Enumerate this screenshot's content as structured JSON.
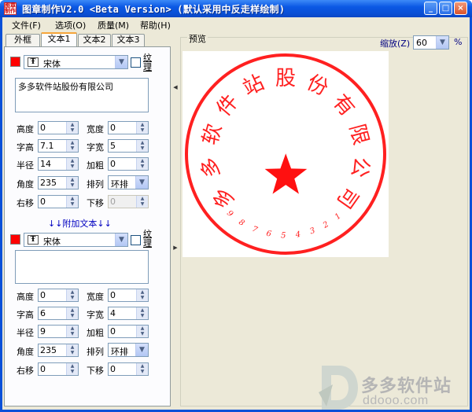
{
  "window": {
    "title": "图章制作V2.0 <Beta Version> (默认采用中反走样绘制)",
    "icon_text": "图章制作",
    "buttons": {
      "minimize": "_",
      "maximize": "□",
      "close": "×"
    }
  },
  "menu": [
    "文件(F)",
    "选项(O)",
    "质量(M)",
    "帮助(H)"
  ],
  "tabs": [
    {
      "label": "外框",
      "active": false
    },
    {
      "label": "文本1",
      "active": true
    },
    {
      "label": "文本2",
      "active": false
    },
    {
      "label": "文本3",
      "active": false
    }
  ],
  "text1": {
    "color": "#ff0000",
    "font": "宋体",
    "font_icon": "Ŧ",
    "texture_label": "纹理",
    "content": "多多软件站股份有限公司",
    "fields": {
      "height_label": "高度",
      "height": "0",
      "width_label": "宽度",
      "width": "0",
      "char_height_label": "字高",
      "char_height": "7.1",
      "char_width_label": "字宽",
      "char_width": "5",
      "radius_label": "半径",
      "radius": "14",
      "bold_label": "加粗",
      "bold": "0",
      "angle_label": "角度",
      "angle": "235",
      "arrange_label": "排列",
      "arrange": "环排",
      "right_label": "右移",
      "right": "0",
      "down_label": "下移",
      "down": "0"
    }
  },
  "extra_text_label": "↓↓附加文本↓↓",
  "text2": {
    "color": "#ff0000",
    "font": "宋体",
    "font_icon": "Ŧ",
    "texture_label": "纹理",
    "content": "",
    "fields": {
      "height_label": "高度",
      "height": "0",
      "width_label": "宽度",
      "width": "0",
      "char_height_label": "字高",
      "char_height": "6",
      "char_width_label": "字宽",
      "char_width": "4",
      "radius_label": "半径",
      "radius": "9",
      "bold_label": "加粗",
      "bold": "0",
      "angle_label": "角度",
      "angle": "235",
      "arrange_label": "排列",
      "arrange": "环排",
      "right_label": "右移",
      "right": "0",
      "down_label": "下移",
      "down": "0"
    }
  },
  "preview": {
    "legend": "预览",
    "zoom_label": "缩放(Z)",
    "zoom_value": "60",
    "zoom_unit": "%",
    "stamp": {
      "color": "#ff2020",
      "ring_text": "多多软件站股份有限公司",
      "number_text": "123456789"
    }
  },
  "watermark": {
    "line1": "多多软件站",
    "line2": "ddooo.com"
  }
}
